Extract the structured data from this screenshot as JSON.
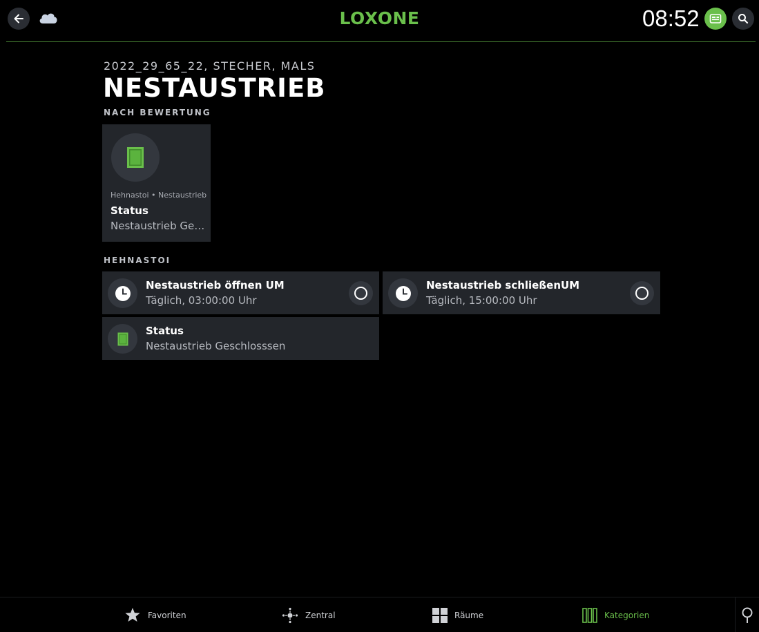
{
  "header": {
    "logo": "LOXONE",
    "time": "08:52",
    "icons": {
      "back": "arrow-left-icon",
      "cloud": "cloud-icon",
      "notify": "notification-icon",
      "search": "search-icon"
    },
    "accent_color": "#6abf4b"
  },
  "page": {
    "breadcrumb": "2022_29_65_22, STECHER, MALS",
    "title": "NESTAUSTRIEB"
  },
  "rated_section": {
    "label": "NACH BEWERTUNG",
    "tile": {
      "room": "Hehnastoi • Nestaustrieb",
      "name": "Status",
      "value": "Nestaustrieb Ges...",
      "icon": "door-icon"
    }
  },
  "room_section": {
    "label": "HEHNASTOI",
    "cards": [
      {
        "title": "Nestaustrieb öffnen UM",
        "subtitle": "Täglich, 03:00:00 Uhr",
        "icon": "clock-icon",
        "action": "circle-toggle-icon"
      },
      {
        "title": "Nestaustrieb schließenUM",
        "subtitle": "Täglich, 15:00:00 Uhr",
        "icon": "clock-icon",
        "action": "circle-toggle-icon"
      },
      {
        "title": "Status",
        "subtitle": "Nestaustrieb Geschlosssen",
        "icon": "door-icon"
      }
    ]
  },
  "bottom_nav": {
    "items": [
      {
        "label": "Favoriten",
        "icon": "star-icon"
      },
      {
        "label": "Zentral",
        "icon": "central-icon"
      },
      {
        "label": "Räume",
        "icon": "rooms-grid-icon"
      },
      {
        "label": "Kategorien",
        "icon": "categories-icon",
        "active": true
      }
    ],
    "extra_icon": "location-pin-icon"
  }
}
